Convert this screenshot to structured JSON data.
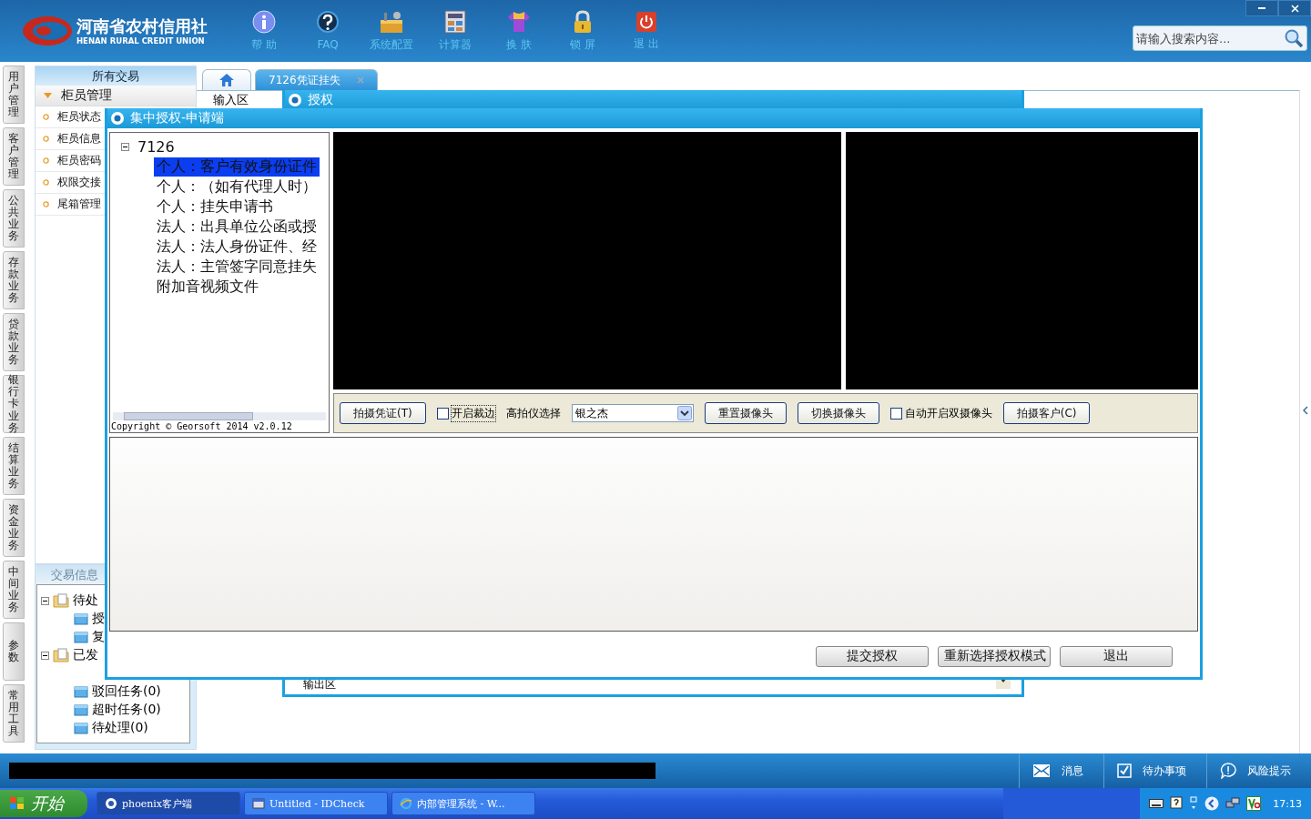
{
  "header": {
    "logo_title": "河南省农村信用社",
    "logo_subtitle": "HENAN RURAL CREDIT UNION",
    "tools": [
      {
        "kind": "info",
        "label": "帮 助"
      },
      {
        "kind": "faq",
        "label": "FAQ"
      },
      {
        "kind": "config",
        "label": "系统配置"
      },
      {
        "kind": "calculator",
        "label": "计算器"
      },
      {
        "kind": "skin",
        "label": "换 肤"
      },
      {
        "kind": "lock",
        "label": "锁 屏"
      },
      {
        "kind": "exit",
        "label": "退 出"
      }
    ],
    "search": {
      "placeholder": "请输入搜索内容..."
    }
  },
  "side_tabs": [
    "用户管理",
    "客户管理",
    "公共业务",
    "存款业务",
    "贷款业务",
    "银行卡业务",
    "结算业务",
    "资金业务",
    "中间业务",
    "参数",
    "常用工具"
  ],
  "nav": {
    "title": "所有交易",
    "group": {
      "label": "柜员管理",
      "expanded": true,
      "items": [
        "柜员状态",
        "柜员信息",
        "柜员密码",
        "权限交接",
        "尾箱管理"
      ]
    }
  },
  "info_panel": {
    "title": "交易信息",
    "tree": [
      {
        "label": "待处",
        "expanded": true,
        "children": [
          {
            "label": "授"
          },
          {
            "label": "复"
          }
        ]
      },
      {
        "label": "已发",
        "expanded": true,
        "children": [
          {
            "label": "驳回任务(0)"
          },
          {
            "label": "超时任务(0)"
          },
          {
            "label": "待处理(0)"
          }
        ]
      }
    ]
  },
  "tabs": [
    {
      "kind": "home",
      "selected": false
    },
    {
      "kind": "text",
      "label": "7126凭证挂失",
      "selected": true
    }
  ],
  "input_area_label": "输入区",
  "output_area_label": "输出区",
  "auth_window": {
    "title": "授权"
  },
  "dialog": {
    "title": "集中授权-申请端",
    "tree": {
      "label": "7126",
      "expanded": true,
      "children": [
        {
          "label": "个人：客户有效身份证件",
          "selected": true
        },
        {
          "label": "个人：（如有代理人时）",
          "selected": false
        },
        {
          "label": "个人：挂失申请书",
          "selected": false
        },
        {
          "label": "法人：出具单位公函或授",
          "selected": false
        },
        {
          "label": "法人：法人身份证件、经",
          "selected": false
        },
        {
          "label": "法人：主管签字同意挂失",
          "selected": false
        },
        {
          "label": "附加音视频文件",
          "selected": false
        }
      ]
    },
    "copyright": "Copyright © Georsoft 2014 v2.0.12",
    "toolbar": [
      {
        "kind": "button",
        "label": "拍摄凭证(T)"
      },
      {
        "kind": "checkbox",
        "label": "开启裁边",
        "checked": false
      },
      {
        "kind": "label",
        "label": "高拍仪选择"
      },
      {
        "kind": "select",
        "label": "银之杰"
      },
      {
        "kind": "button",
        "label": "重置摄像头"
      },
      {
        "kind": "button",
        "label": "切换摄像头"
      },
      {
        "kind": "checkbox",
        "label": "自动开启双摄像头",
        "checked": false
      },
      {
        "kind": "button",
        "label": "拍摄客户(C)"
      }
    ],
    "buttons": [
      "提交授权",
      "重新选择授权模式",
      "退出"
    ]
  },
  "status_bar": {
    "items": [
      {
        "kind": "message",
        "label": "消息"
      },
      {
        "kind": "todo",
        "label": "待办事项"
      },
      {
        "kind": "risk",
        "label": "风险提示"
      }
    ]
  },
  "taskbar": {
    "start": "开始",
    "tasks": [
      {
        "kind": "app",
        "label": "phoenix客户端",
        "selected": true
      },
      {
        "kind": "window",
        "label": "Untitled - IDCheck",
        "selected": false
      },
      {
        "kind": "browser",
        "label": "内部管理系统 - W...",
        "selected": false
      }
    ],
    "clock": "17:13"
  }
}
